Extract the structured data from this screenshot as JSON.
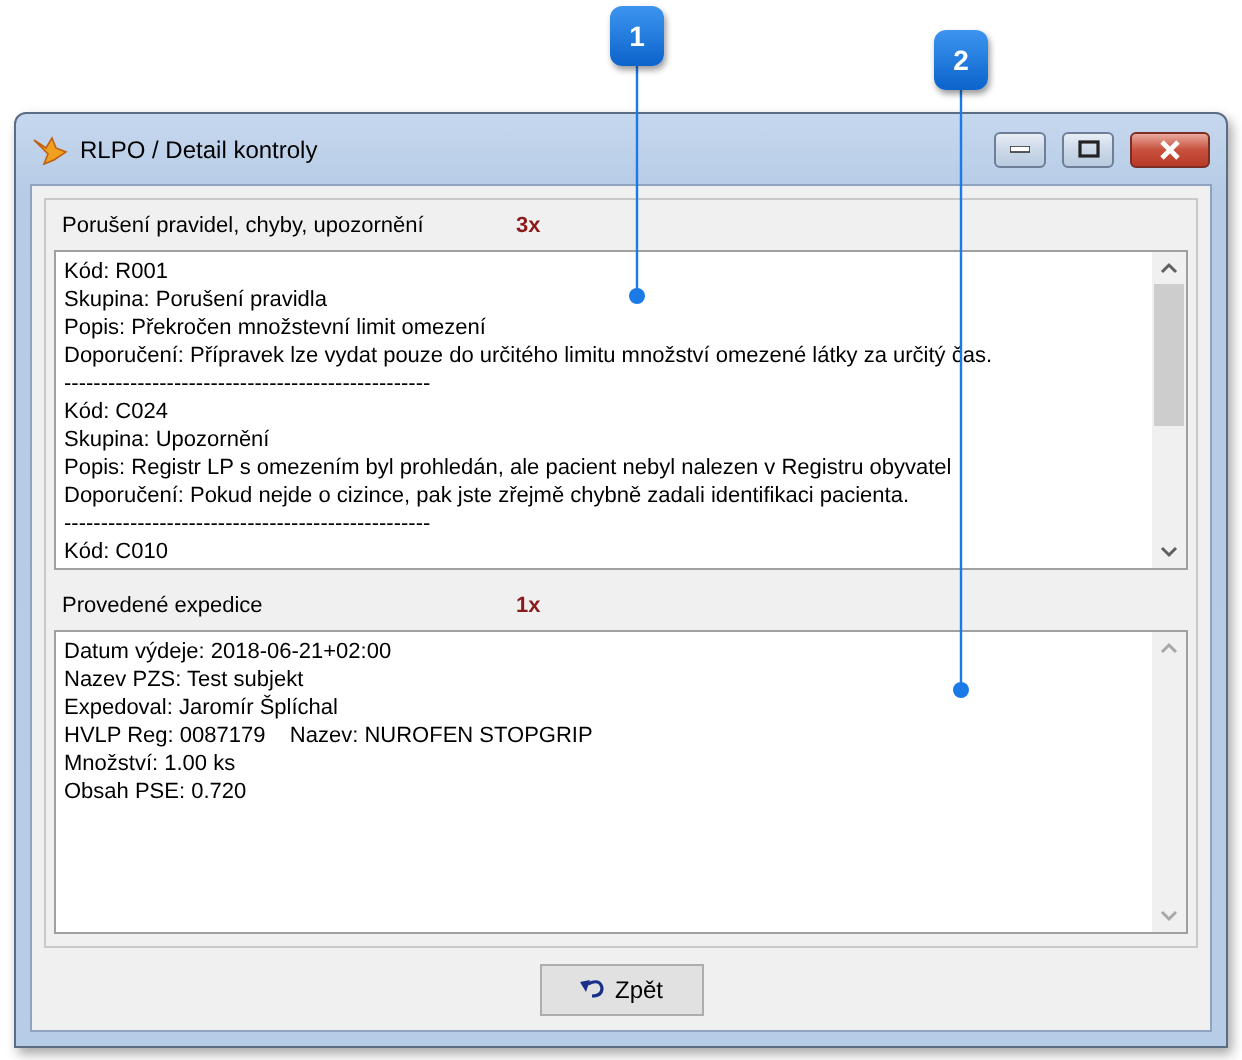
{
  "callouts": [
    {
      "label": "1"
    },
    {
      "label": "2"
    }
  ],
  "window": {
    "title": "RLPO / Detail kontroly"
  },
  "sections": [
    {
      "label": "Porušení pravidel, chyby, upozornění",
      "count": "3x",
      "scrollable": true,
      "lines": [
        "Kód: R001",
        "Skupina: Porušení pravidla",
        "Popis: Překročen množstevní limit omezení",
        "Doporučení: Přípravek lze vydat pouze do určitého limitu množství omezené látky za určitý čas.",
        "--------------------------------------------------",
        "Kód: C024",
        "Skupina: Upozornění",
        "Popis: Registr LP s omezením byl prohledán, ale pacient nebyl nalezen v Registru obyvatel",
        "Doporučení: Pokud nejde o cizince, pak jste zřejmě chybně zadali identifikaci pacienta.",
        "--------------------------------------------------",
        "Kód: C010"
      ]
    },
    {
      "label": "Provedené expedice",
      "count": "1x",
      "scrollable": false,
      "lines": [
        "Datum výdeje: 2018-06-21+02:00",
        "Nazev PZS: Test subjekt",
        "Expedoval: Jaromír Šplíchal",
        "HVLP Reg: 0087179    Nazev: NUROFEN STOPGRIP",
        "Množství: 1.00 ks",
        "Obsah PSE: 0.720"
      ]
    }
  ],
  "button": {
    "label": "Zpět"
  }
}
